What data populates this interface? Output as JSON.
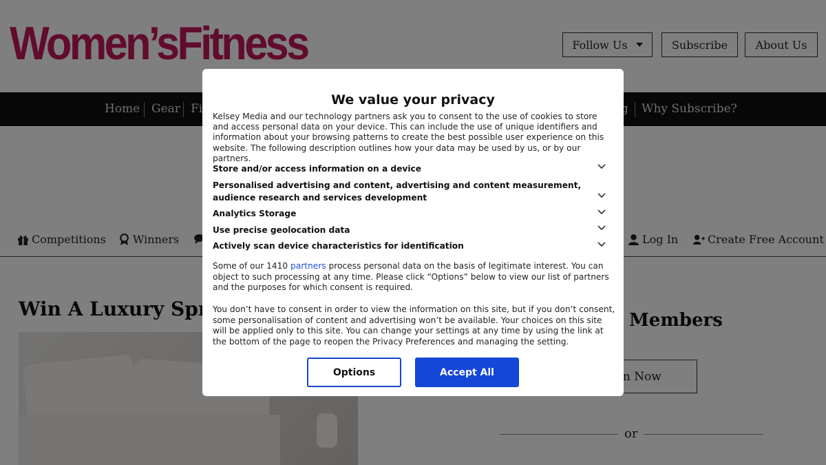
{
  "site": {
    "logo_text": "Women’sFitness",
    "brand_color": "#c2185b"
  },
  "top_buttons": {
    "follow_us": "Follow Us",
    "subscribe": "Subscribe",
    "about_us": "About Us"
  },
  "navbar": {
    "items": [
      "Home",
      "Gear",
      "Fi",
      "g",
      "Why Subscribe?"
    ]
  },
  "subnav": {
    "competitions": "Competitions",
    "winners": "Winners",
    "log_in": "Log In",
    "create_account": "Create Free Account"
  },
  "article": {
    "title": "Win A Luxury Sprin"
  },
  "sidebar": {
    "members_heading": "Members",
    "login_button": "In Now",
    "or_text": "or"
  },
  "consent": {
    "title": "We value your privacy",
    "intro": "Kelsey Media and our technology partners ask you to consent to the use of cookies to store and access personal data on your device. This can include the use of unique identifiers and information about your browsing patterns to create the best possible user experience on this website. The following description outlines how your data may be used by us, or by our partners.",
    "purposes": [
      "Store and/or access information on a device",
      "Personalised advertising and content, advertising and content measurement, audience research and services development",
      "Analytics Storage",
      "Use precise geolocation data",
      "Actively scan device characteristics for identification"
    ],
    "legit_before": "Some of our 1410 ",
    "partners_link": "partners",
    "legit_after": " process personal data on the basis of legitimate interest. You can object to such processing at any time. Please click “Options” below to view our list of partners and the purposes for which consent is required.",
    "choice_text": "You don’t have to consent in order to view the information on this site, but if you don’t consent, some personalisation of content and advertising won’t be available. Your choices on this site will be applied only to this site. You can change your settings at any time by using the link at the bottom of the page to reopen the Privacy Preferences and managing the setting.",
    "options_button": "Options",
    "accept_button": "Accept All",
    "accent_color": "#1446d8"
  }
}
